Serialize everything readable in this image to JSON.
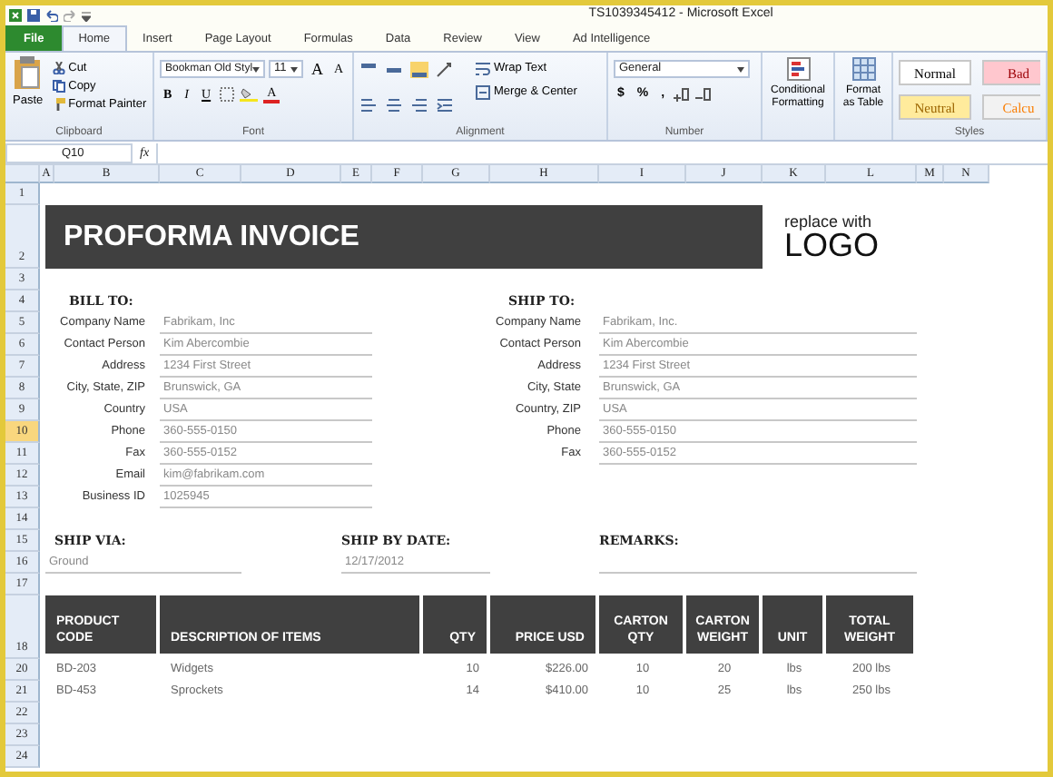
{
  "window": {
    "title": "TS1039345412 - Microsoft Excel"
  },
  "ribbon_tabs": [
    {
      "label": "File",
      "kind": "file",
      "selected": false
    },
    {
      "label": "Home",
      "kind": "tab",
      "selected": true
    },
    {
      "label": "Insert",
      "kind": "tab",
      "selected": false
    },
    {
      "label": "Page Layout",
      "kind": "tab",
      "selected": false
    },
    {
      "label": "Formulas",
      "kind": "tab",
      "selected": false
    },
    {
      "label": "Data",
      "kind": "tab",
      "selected": false
    },
    {
      "label": "Review",
      "kind": "tab",
      "selected": false
    },
    {
      "label": "View",
      "kind": "tab",
      "selected": false
    },
    {
      "label": "Ad Intelligence",
      "kind": "tab",
      "selected": false
    }
  ],
  "ribbon": {
    "clipboard": {
      "label": "Clipboard",
      "paste": "Paste",
      "cut": "Cut",
      "copy": "Copy",
      "format_painter": "Format Painter"
    },
    "font": {
      "label": "Font",
      "name": "Bookman Old Styl",
      "size": "11",
      "grow": "A",
      "shrink": "A",
      "font_color": "A",
      "buttons": [
        {
          "label": "B",
          "kind": "bold"
        },
        {
          "label": "I",
          "kind": "italic"
        },
        {
          "label": "U",
          "kind": "underline"
        }
      ]
    },
    "alignment": {
      "label": "Alignment",
      "wrap_text": "Wrap Text",
      "merge_center": "Merge & Center",
      "vertical": [
        {
          "selected": false
        },
        {
          "selected": false
        },
        {
          "selected": true
        }
      ]
    },
    "number": {
      "label": "Number",
      "format": "General",
      "symbols": [
        "$",
        "%",
        ","
      ]
    },
    "conditional_formatting": "Conditional Formatting",
    "format_as_table": "Format as Table",
    "styles": {
      "label": "Styles",
      "items": [
        {
          "label": "Normal",
          "color": "#ffffff"
        },
        {
          "label": "Bad",
          "color": "#ffc7ce"
        },
        {
          "label": "Neutral",
          "color": "#ffeb9c"
        },
        {
          "label": "Calcu",
          "color": "#f2f2f2"
        }
      ]
    }
  },
  "formula_bar": {
    "name_box": "Q10",
    "function_label": "fx"
  },
  "columns": [
    "A",
    "B",
    "C",
    "D",
    "E",
    "F",
    "G",
    "H",
    "I",
    "J",
    "K",
    "L",
    "M",
    "N"
  ],
  "rows": [
    {
      "label": "1",
      "kind": "normal",
      "selected": false
    },
    {
      "label": "2",
      "kind": "tall",
      "selected": false
    },
    {
      "label": "3",
      "kind": "normal",
      "selected": false
    },
    {
      "label": "4",
      "kind": "normal",
      "selected": false
    },
    {
      "label": "5",
      "kind": "normal",
      "selected": false
    },
    {
      "label": "6",
      "kind": "normal",
      "selected": false
    },
    {
      "label": "7",
      "kind": "normal",
      "selected": false
    },
    {
      "label": "8",
      "kind": "normal",
      "selected": false
    },
    {
      "label": "9",
      "kind": "normal",
      "selected": false
    },
    {
      "label": "10",
      "kind": "normal",
      "selected": true
    },
    {
      "label": "11",
      "kind": "normal",
      "selected": false
    },
    {
      "label": "12",
      "kind": "normal",
      "selected": false
    },
    {
      "label": "13",
      "kind": "normal",
      "selected": false
    },
    {
      "label": "14",
      "kind": "normal",
      "selected": false
    },
    {
      "label": "15",
      "kind": "normal",
      "selected": false
    },
    {
      "label": "16",
      "kind": "normal",
      "selected": false
    },
    {
      "label": "17",
      "kind": "normal",
      "selected": false
    },
    {
      "label": "18",
      "kind": "tall",
      "selected": false
    },
    {
      "label": "20",
      "kind": "normal",
      "selected": false
    },
    {
      "label": "21",
      "kind": "normal",
      "selected": false
    },
    {
      "label": "22",
      "kind": "normal",
      "selected": false
    },
    {
      "label": "23",
      "kind": "normal",
      "selected": false
    },
    {
      "label": "24",
      "kind": "normal",
      "selected": false
    }
  ],
  "invoice": {
    "title": "PROFORMA INVOICE",
    "logo": {
      "line1": "replace with",
      "line2": "LOGO"
    },
    "bill_to": {
      "heading": "BILL TO:",
      "fields": [
        {
          "label": "Company Name",
          "value": "Fabrikam, Inc"
        },
        {
          "label": "Contact Person",
          "value": "Kim Abercombie"
        },
        {
          "label": "Address",
          "value": "1234 First Street"
        },
        {
          "label": "City, State, ZIP",
          "value": "Brunswick, GA"
        },
        {
          "label": "Country",
          "value": "USA"
        },
        {
          "label": "Phone",
          "value": "360-555-0150"
        },
        {
          "label": "Fax",
          "value": "360-555-0152"
        },
        {
          "label": "Email",
          "value": "kim@fabrikam.com"
        },
        {
          "label": "Business ID",
          "value": "1025945"
        }
      ]
    },
    "ship_to": {
      "heading": "SHIP TO:",
      "fields": [
        {
          "label": "Company Name",
          "value": "Fabrikam, Inc."
        },
        {
          "label": "Contact Person",
          "value": "Kim Abercombie"
        },
        {
          "label": "Address",
          "value": "1234 First Street"
        },
        {
          "label": "City, State",
          "value": "Brunswick, GA"
        },
        {
          "label": "Country, ZIP",
          "value": "USA"
        },
        {
          "label": "Phone",
          "value": "360-555-0150"
        },
        {
          "label": "Fax",
          "value": "360-555-0152"
        }
      ]
    },
    "ship_via": {
      "heading": "SHIP VIA:",
      "value": "Ground"
    },
    "ship_by_date": {
      "heading": "SHIP BY DATE:",
      "value": "12/17/2012"
    },
    "remarks": {
      "heading": "REMARKS:"
    },
    "items_table": {
      "columns": [
        "PRODUCT CODE",
        "DESCRIPTION OF ITEMS",
        "QTY",
        "PRICE USD",
        "CARTON QTY",
        "CARTON WEIGHT",
        "UNIT",
        "TOTAL WEIGHT"
      ],
      "rows": [
        [
          "BD-203",
          "Widgets",
          "10",
          "$226.00",
          "10",
          "20",
          "lbs",
          "200 lbs"
        ],
        [
          "BD-453",
          "Sprockets",
          "14",
          "$410.00",
          "10",
          "25",
          "lbs",
          "250 lbs"
        ]
      ]
    }
  }
}
